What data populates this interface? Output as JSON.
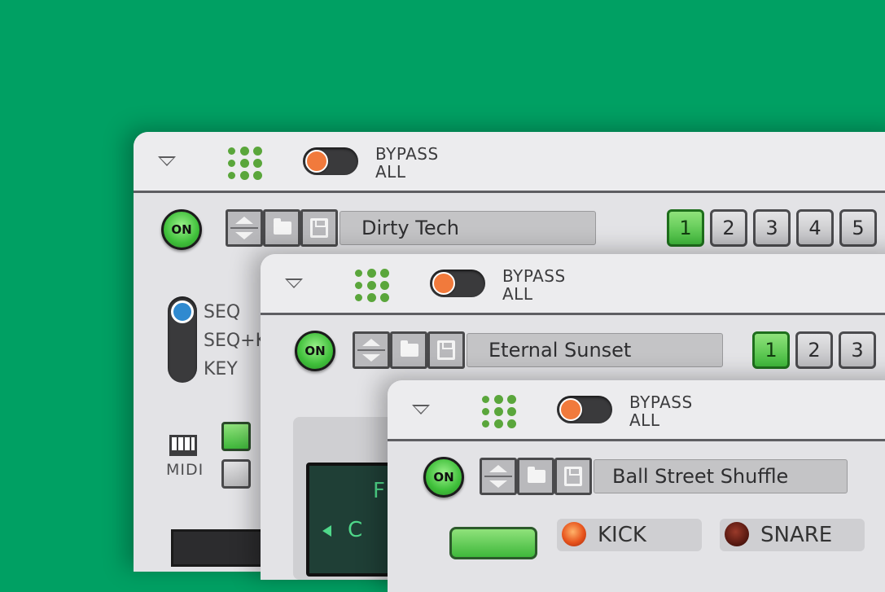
{
  "panels": [
    {
      "bypass_label": "BYPASS\nALL",
      "on_label": "ON",
      "preset_name": "Dirty Tech",
      "pattern_numbers": [
        "1",
        "2",
        "3",
        "4",
        "5"
      ],
      "active_pattern": "1",
      "mode_options": [
        "SEQ",
        "SEQ+K",
        "KEY"
      ],
      "selected_mode": "SEQ",
      "midi_label": "MIDI"
    },
    {
      "bypass_label": "BYPASS\nALL",
      "on_label": "ON",
      "preset_name": "Eternal Sunset",
      "pattern_numbers": [
        "1",
        "2",
        "3"
      ],
      "active_pattern": "1",
      "display_lines": [
        "F",
        "C"
      ]
    },
    {
      "bypass_label": "BYPASS\nALL",
      "on_label": "ON",
      "preset_name": "Ball Street Shuffle",
      "pads": [
        "KICK",
        "SNARE"
      ]
    }
  ],
  "colors": {
    "background": "#00a063",
    "accent_green": "#3fb83b",
    "toggle_knob": "#f17a3c",
    "mode_knob": "#2f8ad0",
    "dot_grid": "#5aa63b"
  },
  "icons": [
    "dropdown-triangle-icon",
    "dot-grid-logo-icon",
    "preset-arrows-icon",
    "folder-icon",
    "save-icon",
    "piano-keys-icon"
  ]
}
